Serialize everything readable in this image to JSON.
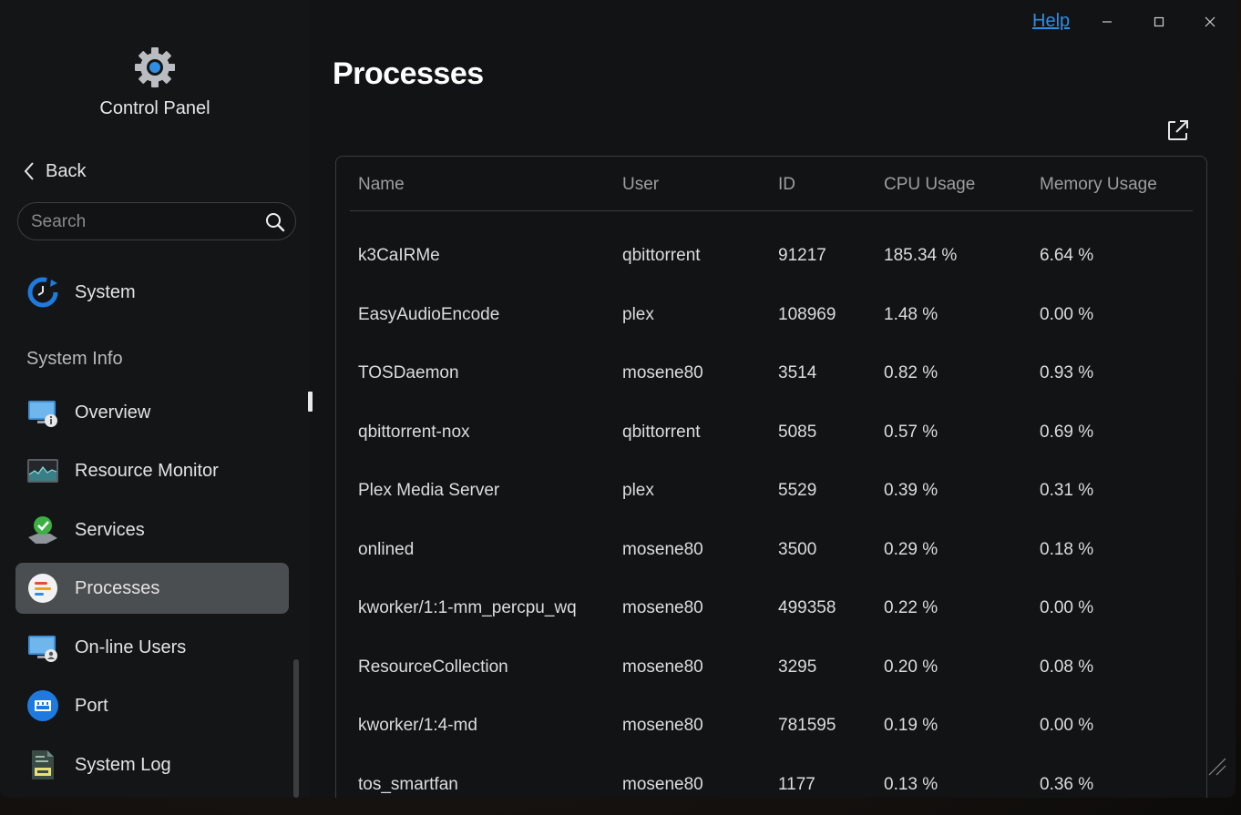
{
  "window": {
    "help_label": "Help",
    "page_title": "Processes"
  },
  "sidebar": {
    "app_title": "Control Panel",
    "back_label": "Back",
    "search_placeholder": "Search",
    "system_label": "System",
    "section_label": "System Info",
    "items": [
      {
        "label": "Overview",
        "icon": "monitor-info-icon"
      },
      {
        "label": "Resource Monitor",
        "icon": "resource-monitor-icon"
      },
      {
        "label": "Services",
        "icon": "services-check-icon"
      },
      {
        "label": "Processes",
        "icon": "processes-icon",
        "active": true
      },
      {
        "label": "On-line Users",
        "icon": "online-users-icon"
      },
      {
        "label": "Port",
        "icon": "port-icon"
      },
      {
        "label": "System Log",
        "icon": "system-log-icon"
      }
    ]
  },
  "table": {
    "columns": [
      "Name",
      "User",
      "ID",
      "CPU Usage",
      "Memory Usage"
    ],
    "rows": [
      [
        "k3CaIRMe",
        "qbittorrent",
        "91217",
        "185.34 %",
        "6.64 %"
      ],
      [
        "EasyAudioEncode",
        "plex",
        "108969",
        "1.48 %",
        "0.00 %"
      ],
      [
        "TOSDaemon",
        "mosene80",
        "3514",
        "0.82 %",
        "0.93 %"
      ],
      [
        "qbittorrent-nox",
        "qbittorrent",
        "5085",
        "0.57 %",
        "0.69 %"
      ],
      [
        "Plex Media Server",
        "plex",
        "5529",
        "0.39 %",
        "0.31 %"
      ],
      [
        "onlined",
        "mosene80",
        "3500",
        "0.29 %",
        "0.18 %"
      ],
      [
        "kworker/1:1-mm_percpu_wq",
        "mosene80",
        "499358",
        "0.22 %",
        "0.00 %"
      ],
      [
        "ResourceCollection",
        "mosene80",
        "3295",
        "0.20 %",
        "0.08 %"
      ],
      [
        "kworker/1:4-md",
        "mosene80",
        "781595",
        "0.19 %",
        "0.00 %"
      ],
      [
        "tos_smartfan",
        "mosene80",
        "1177",
        "0.13 %",
        "0.36 %"
      ]
    ]
  },
  "colors": {
    "accent": "#2f8de4",
    "window_bg": "#121315",
    "active_item_bg": "#4b4e51"
  }
}
